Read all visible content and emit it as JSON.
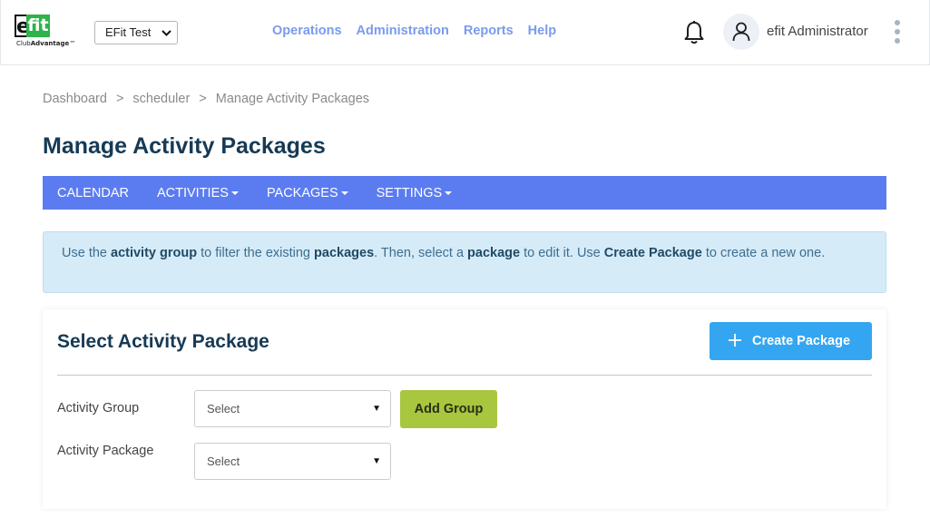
{
  "header": {
    "logo_main_left": "e",
    "logo_main_right": "fit",
    "logo_sub_prefix": "Club",
    "logo_sub_bold": "Advantage",
    "logo_sub_tm": "™",
    "club_select_value": "EFit Test",
    "nav": [
      "Operations",
      "Administration",
      "Reports",
      "Help"
    ],
    "user_name": "efit Administrator"
  },
  "breadcrumb": [
    "Dashboard",
    "scheduler",
    "Manage Activity Packages"
  ],
  "breadcrumb_separator": ">",
  "page_title": "Manage Activity Packages",
  "subnav": [
    {
      "label": "CALENDAR",
      "dropdown": false
    },
    {
      "label": "ACTIVITIES",
      "dropdown": true
    },
    {
      "label": "PACKAGES",
      "dropdown": true
    },
    {
      "label": "SETTINGS",
      "dropdown": true
    }
  ],
  "info": {
    "t1": "Use the ",
    "b1": "activity group",
    "t2": " to filter the existing ",
    "b2": "packages",
    "t3": ". Then, select a ",
    "b3": "package",
    "t4": " to edit it. Use ",
    "b4": "Create Package",
    "t5": " to create a new one."
  },
  "card": {
    "title": "Select Activity Package",
    "create_button": "Create Package",
    "activity_group_label": "Activity Group",
    "activity_group_value": "Select",
    "add_group_button": "Add Group",
    "activity_package_label": "Activity Package",
    "activity_package_value": "Select"
  },
  "colors": {
    "nav_link": "#7a9bed",
    "subnav_bg": "#5b7cf1",
    "title": "#163a55",
    "create_btn": "#34a6f1",
    "add_group_btn": "#a8c63e",
    "info_bg": "#d6ebf8",
    "logo_green": "#2db34a"
  },
  "icons": {
    "bell": "bell-icon",
    "user": "user-icon",
    "menu": "kebab-menu-icon",
    "plus": "plus-icon",
    "caret": "caret-down-icon"
  }
}
